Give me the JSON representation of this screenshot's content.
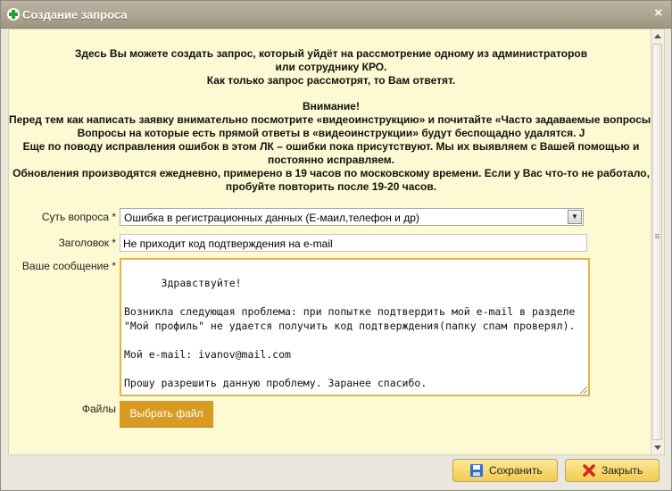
{
  "window": {
    "title": "Создание запроса",
    "close_glyph": "×"
  },
  "notice": {
    "lines1": [
      "Здесь Вы можете создать запрос, который уйдёт на рассмотрение одному из администраторов",
      "или сотруднику КРО.",
      "Как только запрос рассмотрят, то Вам ответят."
    ],
    "lines2": [
      "Внимание!",
      "Перед тем как написать заявку внимательно посмотрите «видеоинструкцию» и почитайте «Часто задаваемые вопросы».",
      "Вопросы на которые есть прямой ответы в «видеоинструкции» будут беспощадно удалятся. J",
      "Еще по поводу исправления ошибок в этом ЛК – ошибки пока присутствуют. Мы их выявляем с Вашей помощью и",
      "постоянно исправляем.",
      "Обновления производятся ежедневно, примерено в 19 часов по московскому времени. Если у Вас что-то не работало,",
      "пробуйте повторить после 19-20 часов."
    ]
  },
  "form": {
    "topic_label": "Суть вопроса *",
    "topic_value": "Ошибка в регистрационных данных (E-маил,телефон и др)",
    "subject_label": "Заголовок *",
    "subject_value": "Не приходит код подтверждения на e-mail",
    "message_label": "Ваше сообщение *",
    "message_value": "Здравствуйте!\n\nВозникла следующая проблема: при попытке подтвердить мой e-mail в разделе \"Мой профиль\" не удается получить код подтверждения(папку спам проверял).\n\nМой e-mail: ivanov@mail.com\n\nПрошу разрешить данную проблему. Заранее спасибо.",
    "files_label": "Файлы",
    "choose_file_label": "Выбрать файл"
  },
  "footer": {
    "save_label": "Сохранить",
    "close_label": "Закрыть"
  },
  "icons": {
    "title": "plus-icon",
    "save": "floppy-disk-icon",
    "close": "close-x-icon",
    "select": "chevron-down-icon"
  },
  "colors": {
    "accent": "#d89a20",
    "background": "#fdf9d2",
    "focus_border": "#e3b34a"
  }
}
